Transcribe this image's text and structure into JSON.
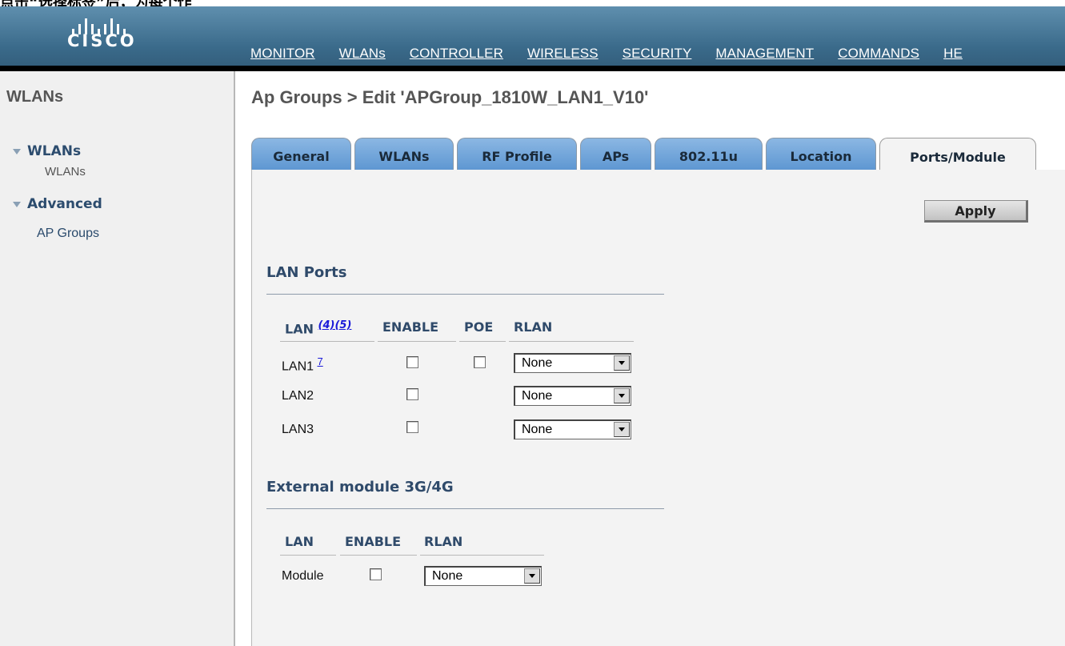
{
  "caption": "点击“选择标签”后，为每个作",
  "brand": {
    "logo_text": "CISCO"
  },
  "nav": {
    "items": [
      {
        "label": "MONITOR",
        "active": false
      },
      {
        "label": "WLANs",
        "active": true
      },
      {
        "label": "CONTROLLER",
        "active": false
      },
      {
        "label": "WIRELESS",
        "active": false
      },
      {
        "label": "SECURITY",
        "active": false
      },
      {
        "label": "MANAGEMENT",
        "active": false
      },
      {
        "label": "COMMANDS",
        "active": false
      },
      {
        "label": "HE",
        "active": false
      }
    ]
  },
  "sidebar": {
    "title": "WLANs",
    "sections": [
      {
        "label": "WLANs",
        "items": [
          "WLANs"
        ]
      },
      {
        "label": "Advanced",
        "items": [
          "AP Groups"
        ]
      }
    ]
  },
  "page": {
    "title": "Ap Groups > Edit  'APGroup_1810W_LAN1_V10'"
  },
  "tabs": [
    {
      "label": "General",
      "active": false
    },
    {
      "label": "WLANs",
      "active": false
    },
    {
      "label": "RF Profile",
      "active": false
    },
    {
      "label": "APs",
      "active": false
    },
    {
      "label": "802.11u",
      "active": false
    },
    {
      "label": "Location",
      "active": false
    },
    {
      "label": "Ports/Module",
      "active": true
    }
  ],
  "apply_label": "Apply",
  "lan_ports": {
    "title": "LAN Ports",
    "headers": {
      "lan": "LAN",
      "lan_note": "(4)(5)",
      "enable": "ENABLE",
      "poe": "POE",
      "rlan": "RLAN"
    },
    "rows": [
      {
        "name": "LAN1",
        "note": "7",
        "enable": false,
        "poe": false,
        "rlan": "None"
      },
      {
        "name": "LAN2",
        "note": "",
        "enable": false,
        "rlan": "None"
      },
      {
        "name": "LAN3",
        "note": "",
        "enable": false,
        "rlan": "None"
      }
    ]
  },
  "external_module": {
    "title": "External module 3G/4G",
    "headers": {
      "lan": "LAN",
      "enable": "ENABLE",
      "rlan": "RLAN"
    },
    "rows": [
      {
        "name": "Module",
        "enable": false,
        "rlan": "None"
      }
    ]
  },
  "colors": {
    "topbar": "#3a6a8a",
    "tab_blue": "#6fa3d8",
    "section_text": "#2f4a6a",
    "link_blue": "#1a1ad8"
  }
}
